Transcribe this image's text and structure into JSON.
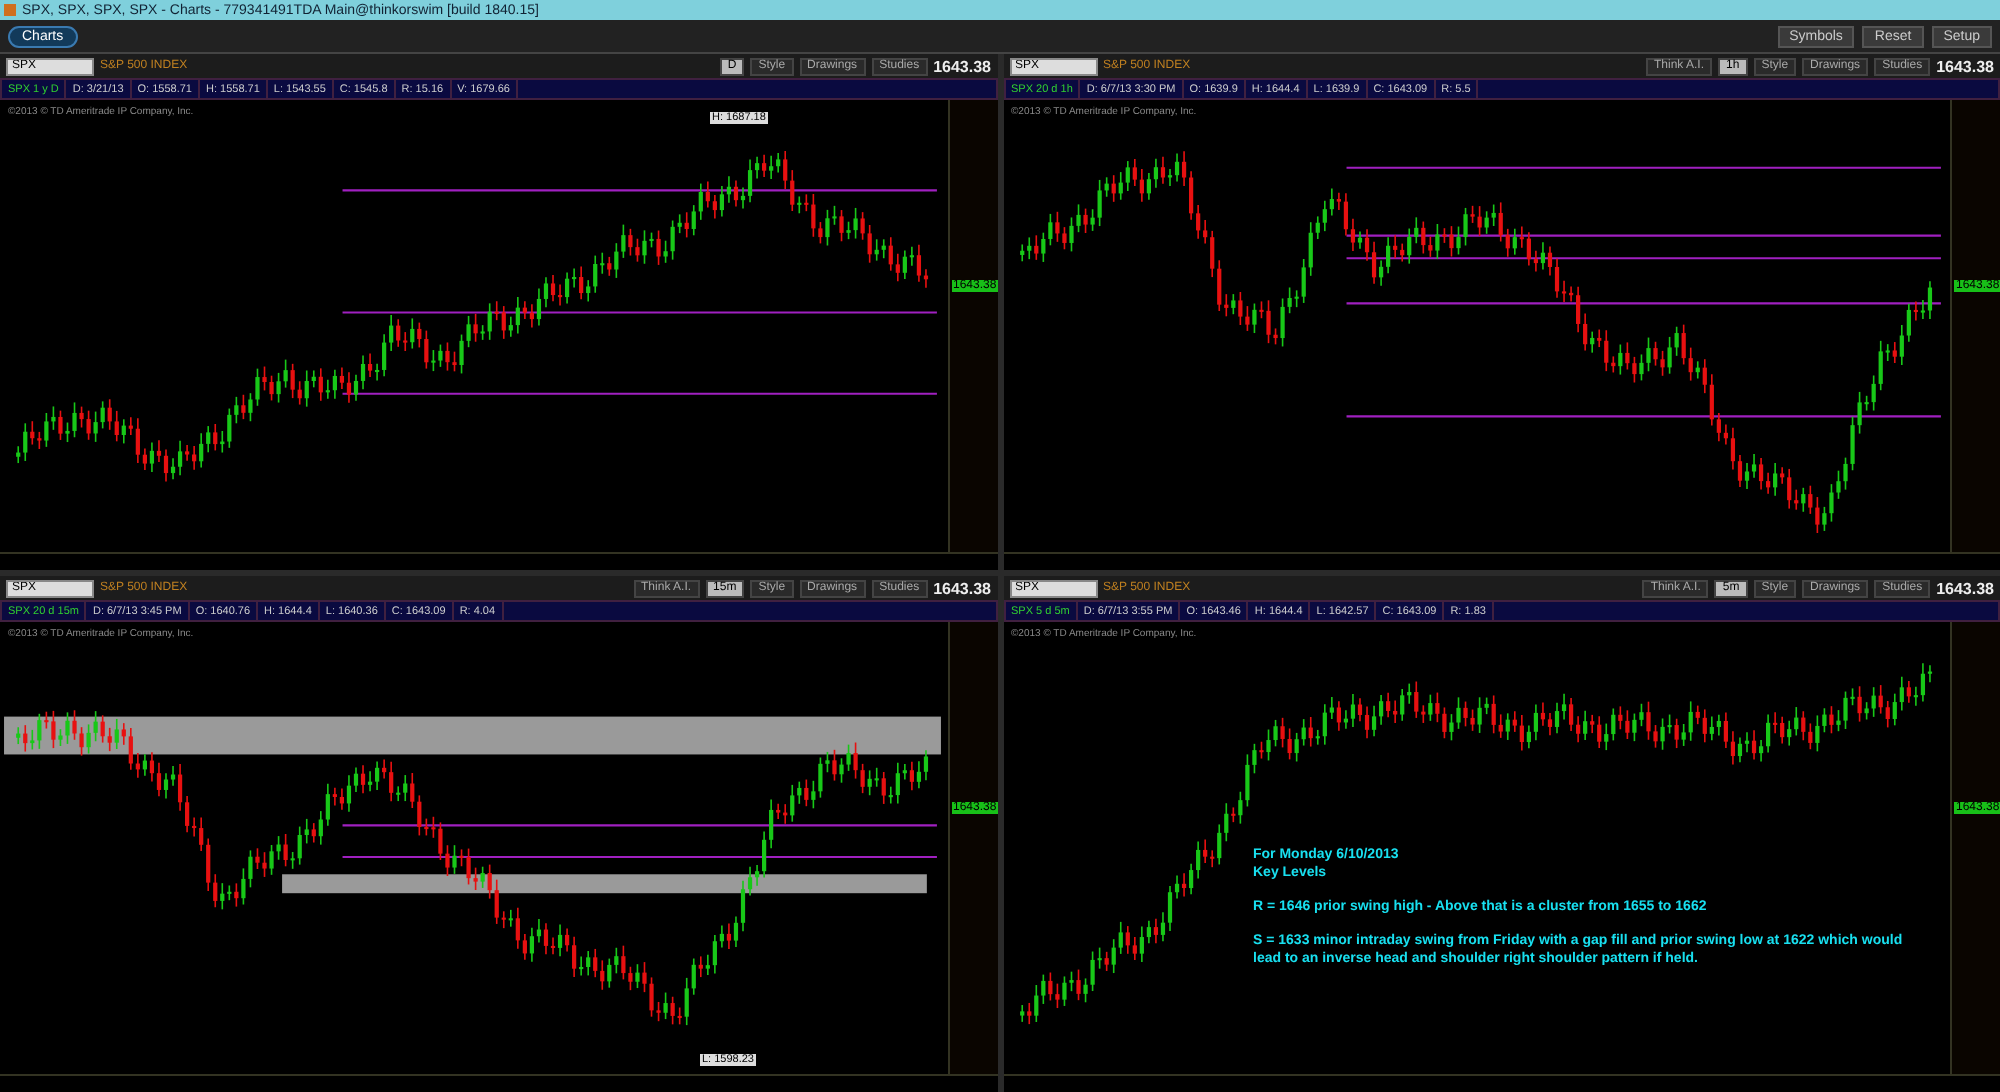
{
  "window": {
    "title": "SPX, SPX, SPX, SPX - Charts - 779341491TDA Main@thinkorswim [build 1840.15]"
  },
  "tabs": [
    {
      "label": "Charts",
      "selected": true
    }
  ],
  "toolbar": {
    "buttons": [
      "Symbols",
      "Reset",
      "Setup"
    ]
  },
  "charts": [
    {
      "symbol": "SPX",
      "description": "S&P 500 INDEX",
      "aggregation": "D",
      "buttons": [
        "Style",
        "Drawings",
        "Studies"
      ],
      "last": "1643.38",
      "info": [
        "SPX 1 y D",
        "D: 3/21/13",
        "O: 1558.71",
        "H: 1558.71",
        "L: 1543.55",
        "C: 1545.8",
        "R: 15.16",
        "V: 1679.66"
      ],
      "price_tag": "1643.38",
      "copyright": "©2013 © TD Ameritrade IP Company, Inc.",
      "label": "H: 1687.18"
    },
    {
      "symbol": "SPX",
      "description": "S&P 500 INDEX",
      "think": "Think A.I.",
      "aggregation": "1h",
      "buttons": [
        "Style",
        "Drawings",
        "Studies"
      ],
      "last": "1643.38",
      "info": [
        "SPX 20 d 1h",
        "D: 6/7/13 3:30 PM",
        "O: 1639.9",
        "H: 1644.4",
        "L: 1639.9",
        "C: 1643.09",
        "R: 5.5"
      ],
      "price_tag": "1643.38",
      "copyright": "©2013 © TD Ameritrade IP Company, Inc."
    },
    {
      "symbol": "SPX",
      "description": "S&P 500 INDEX",
      "think": "Think A.I.",
      "aggregation": "15m",
      "buttons": [
        "Style",
        "Drawings",
        "Studies"
      ],
      "last": "1643.38",
      "info": [
        "SPX 20 d 15m",
        "D: 6/7/13 3:45 PM",
        "O: 1640.76",
        "H: 1644.4",
        "L: 1640.36",
        "C: 1643.09",
        "R: 4.04"
      ],
      "price_tag": "1643.38",
      "copyright": "©2013 © TD Ameritrade IP Company, Inc.",
      "label": "L: 1598.23"
    },
    {
      "symbol": "SPX",
      "description": "S&P 500 INDEX",
      "think": "Think A.I.",
      "aggregation": "5m",
      "buttons": [
        "Style",
        "Drawings",
        "Studies"
      ],
      "last": "1643.38",
      "info": [
        "SPX 5 d 5m",
        "D: 6/7/13 3:55 PM",
        "O: 1643.46",
        "H: 1644.4",
        "L: 1642.57",
        "C: 1643.09",
        "R: 1.83"
      ],
      "price_tag": "1643.38",
      "copyright": "©2013 © TD Ameritrade IP Company, Inc.",
      "notes": [
        "For Monday 6/10/2013",
        "Key Levels",
        "R = 1646 prior swing high - Above that is a cluster from 1655 to 1662",
        "S = 1633 minor intraday swing from Friday with a gap fill and prior swing low at 1622 which would lead to an inverse head and shoulder right shoulder pattern if held."
      ]
    }
  ]
}
